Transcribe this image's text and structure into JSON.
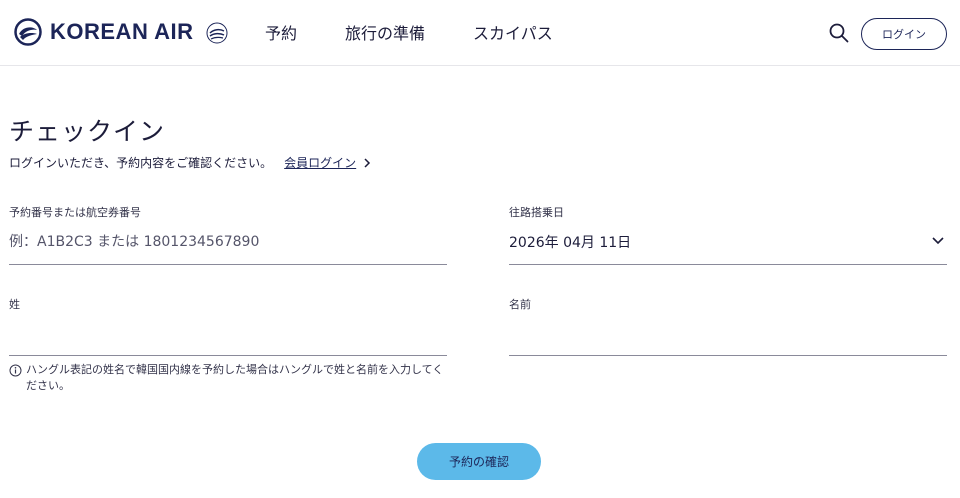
{
  "header": {
    "logo_text": "KOREAN AIR",
    "nav": [
      {
        "label": "予約"
      },
      {
        "label": "旅行の準備"
      },
      {
        "label": "スカイパス"
      }
    ],
    "login_label": "ログイン"
  },
  "main": {
    "title": "チェックイン",
    "subtext": "ログインいただき、予約内容をご確認ください。",
    "member_login_link": "会員ログイン",
    "fields": {
      "pnr": {
        "label": "予約番号または航空券番号",
        "placeholder": "例：A1B2C3 または 1801234567890",
        "value": ""
      },
      "date": {
        "label": "往路搭乗日",
        "value": "2026年 04月 11日"
      },
      "last_name": {
        "label": "姓",
        "value": ""
      },
      "first_name": {
        "label": "名前",
        "value": ""
      }
    },
    "notice": "ハングル表記の姓名で韓国国内線を予約した場合はハングルで姓と名前を入力してください。",
    "confirm_button": "予約の確認"
  },
  "colors": {
    "brand_navy": "#1c2558",
    "confirm_button_bg": "#5cb9e9"
  },
  "icons": [
    "korean-air-logo-icon",
    "skyteam-logo-icon",
    "search-icon",
    "chevron-right-icon",
    "chevron-down-icon",
    "info-icon"
  ]
}
